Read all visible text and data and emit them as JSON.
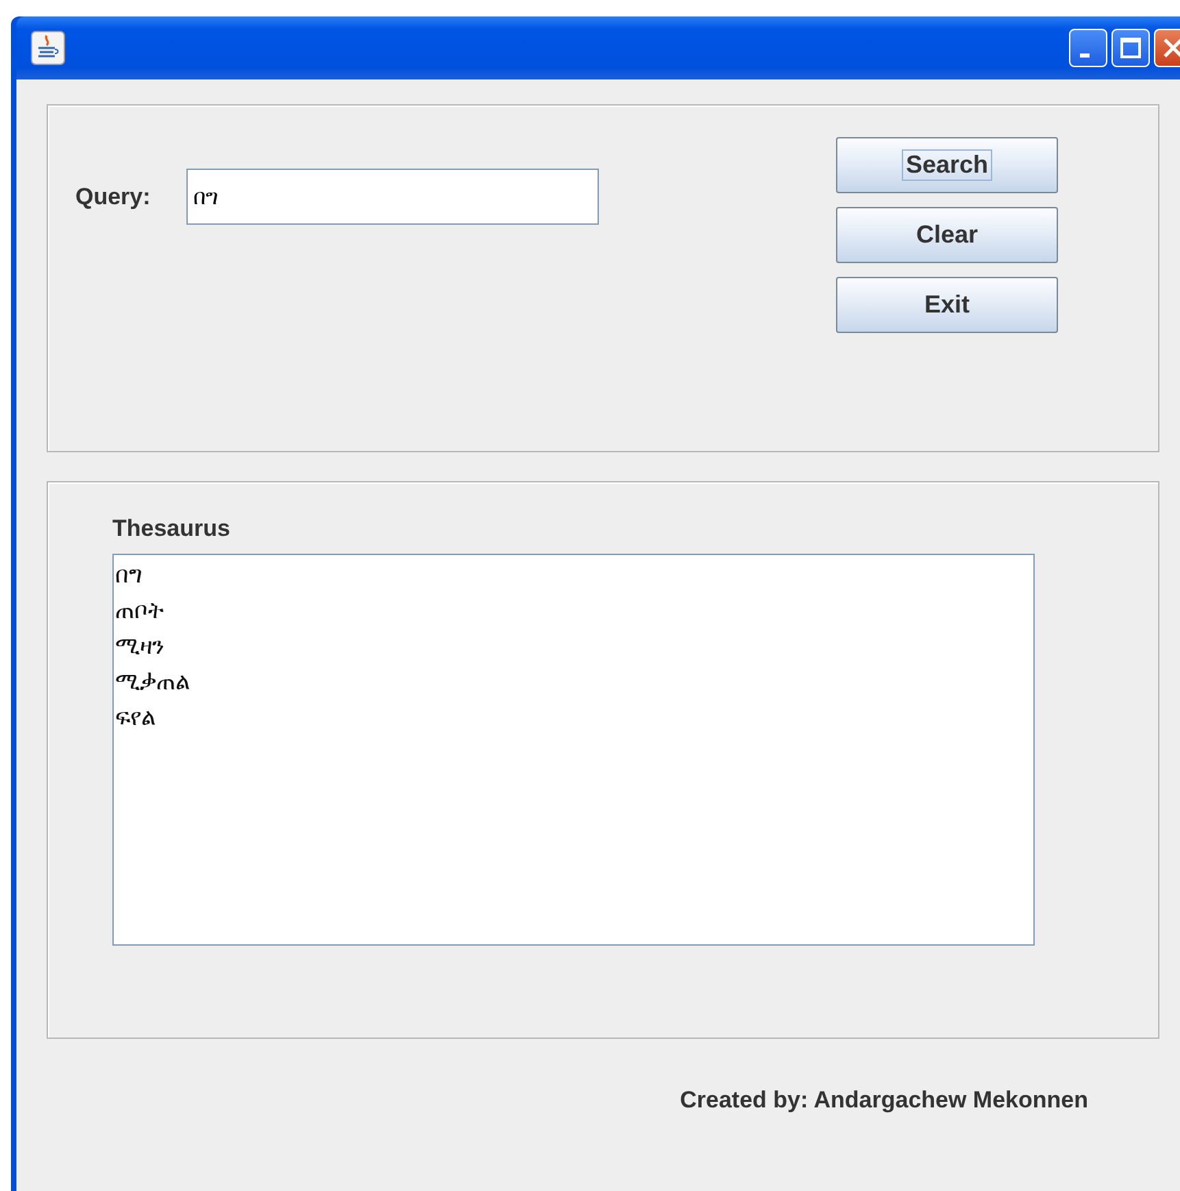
{
  "window": {
    "title_bar": {
      "buttons": [
        {
          "kind": "minimize"
        },
        {
          "kind": "maximize"
        },
        {
          "kind": "close"
        }
      ]
    }
  },
  "query": {
    "label": "Query:",
    "value": "በግ"
  },
  "buttons": [
    {
      "label": "Search",
      "focused": true
    },
    {
      "label": "Clear",
      "focused": false
    },
    {
      "label": "Exit",
      "focused": false
    }
  ],
  "thesaurus": {
    "label": "Thesaurus",
    "items": [
      "በግ",
      "ጠቦት",
      "ሚዛን",
      "ሚቃጠል",
      "ፍየል"
    ]
  },
  "footer": "Created by: Andargachew Mekonnen"
}
